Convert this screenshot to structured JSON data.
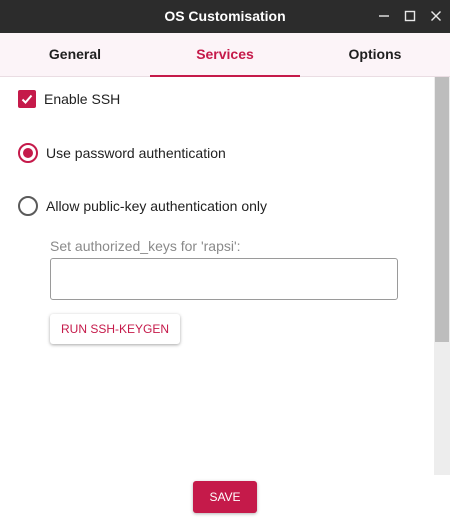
{
  "window": {
    "title": "OS Customisation",
    "controls": [
      "minimize-icon",
      "maximize-icon",
      "close-icon"
    ]
  },
  "tabs": [
    {
      "label": "General",
      "active": false
    },
    {
      "label": "Services",
      "active": true
    },
    {
      "label": "Options",
      "active": false
    }
  ],
  "services": {
    "enable_ssh": {
      "label": "Enable SSH",
      "checked": true
    },
    "auth_password": {
      "label": "Use password authentication",
      "selected": true
    },
    "auth_pubkey": {
      "label": "Allow public-key authentication only",
      "selected": false
    },
    "authorized_keys": {
      "label": "Set authorized_keys for 'rapsi':",
      "value": ""
    },
    "keygen_button": "RUN SSH-KEYGEN"
  },
  "footer": {
    "save_label": "SAVE"
  },
  "colors": {
    "accent": "#c51a4a",
    "titlebar": "#2c2c2c",
    "tabbar": "#fcf4f8"
  }
}
